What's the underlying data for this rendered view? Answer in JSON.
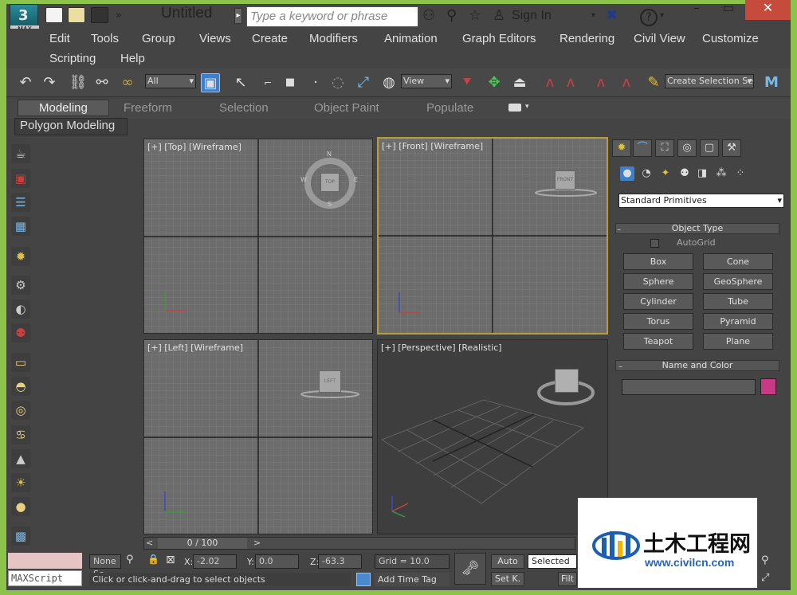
{
  "title_bar": {
    "logo_text": "MAX",
    "title": "Untitled",
    "search_placeholder": "Type a keyword or phrase",
    "sign_in": "Sign In",
    "help_glyph": "?"
  },
  "menu": [
    "Edit",
    "Tools",
    "Group",
    "Views",
    "Create",
    "Modifiers",
    "Animation",
    "Graph Editors",
    "Rendering",
    "Civil View",
    "Customize",
    "Scripting",
    "Help"
  ],
  "toolbar": {
    "filter_value": "All",
    "ref_coord_value": "View",
    "selection_set_placeholder": "Create Selection Se"
  },
  "ribbon": {
    "tabs": [
      "Modeling",
      "Freeform",
      "Selection",
      "Object Paint",
      "Populate"
    ],
    "active_tab": "Modeling",
    "panel_label": "Polygon Modeling"
  },
  "viewports": {
    "top": "[+] [Top] [Wireframe]",
    "front": "[+] [Front] [Wireframe]",
    "left": "[+] [Left] [Wireframe]",
    "perspective": "[+] [Perspective] [Realistic]",
    "viewcube_top": "TOP",
    "viewcube_front": "FRONT",
    "viewcube_left": "LEFT",
    "compass": {
      "n": "N",
      "s": "S",
      "e": "E",
      "w": "W"
    }
  },
  "command_panel": {
    "category_value": "Standard Primitives",
    "object_type_title": "Object Type",
    "autogrid_label": "AutoGrid",
    "objects": [
      "Box",
      "Cone",
      "Sphere",
      "GeoSphere",
      "Cylinder",
      "Tube",
      "Torus",
      "Pyramid",
      "Teapot",
      "Plane"
    ],
    "name_color_title": "Name and Color",
    "color_swatch": "#c73a84"
  },
  "timeline": {
    "frame_label": "0 / 100"
  },
  "status": {
    "maxscript_label": "MAXScript",
    "selection_value": "None Se",
    "x_label": "X:",
    "x_value": "-2.02",
    "y_label": "Y:",
    "y_value": "0.0",
    "z_label": "Z:",
    "z_value": "-63.3",
    "grid_value": "Grid = 10.0",
    "auto_label": "Auto",
    "selected_value": "Selected",
    "setk_label": "Set K.",
    "filters_label": "Filt",
    "prompt": "Click or click-and-drag to select objects",
    "add_time_tag": "Add Time Tag"
  },
  "watermark": {
    "brand_cn": "土木工程网",
    "url": "www.civilcn.com"
  },
  "colors": {
    "chrome": "#8cc34a",
    "ui_bg": "#444444",
    "viewport": "#6c6c6c",
    "active_border": "#b89c3b",
    "close_button": "#c74b3c"
  }
}
